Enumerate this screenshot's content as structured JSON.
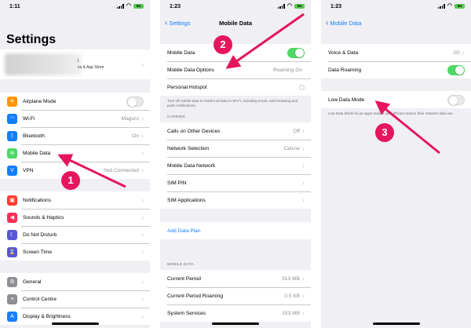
{
  "theme": {
    "accent": "#147efb",
    "toggle_on": "#4cd964",
    "annotation": "#e5165d"
  },
  "s1": {
    "time": "1:11",
    "battery": "84",
    "title": "Settings",
    "profile": {
      "line1": "i",
      "line2": "es & App Store"
    },
    "g1": [
      {
        "label": "Airplane Mode",
        "icon": "airplane-icon",
        "color": "#ff9500",
        "glyph": "✈",
        "toggle": "off"
      },
      {
        "label": "Wi-Fi",
        "icon": "wifi-icon",
        "color": "#147efb",
        "glyph": "◠",
        "value": "Maguro"
      },
      {
        "label": "Bluetooth",
        "icon": "bluetooth-icon",
        "color": "#147efb",
        "glyph": "ᛒ",
        "value": "On"
      },
      {
        "label": "Mobile Data",
        "icon": "antenna-icon",
        "color": "#4cd964",
        "glyph": "⊚",
        "value": ""
      },
      {
        "label": "VPN",
        "icon": "vpn-icon",
        "color": "#147efb",
        "glyph": "V",
        "value": "Not Connected"
      }
    ],
    "g2": [
      {
        "label": "Notifications",
        "icon": "notifications-icon",
        "color": "#ff3b30",
        "glyph": "▣"
      },
      {
        "label": "Sounds & Haptics",
        "icon": "speaker-icon",
        "color": "#ff2d55",
        "glyph": "◀"
      },
      {
        "label": "Do Not Disturb",
        "icon": "moon-icon",
        "color": "#5856d6",
        "glyph": "☾"
      },
      {
        "label": "Screen Time",
        "icon": "hourglass-icon",
        "color": "#5856d6",
        "glyph": "⌛"
      }
    ],
    "g3": [
      {
        "label": "General",
        "icon": "gear-icon",
        "color": "#8e8e93",
        "glyph": "⚙"
      },
      {
        "label": "Control Centre",
        "icon": "toggles-icon",
        "color": "#8e8e93",
        "glyph": "≡"
      },
      {
        "label": "Display & Brightness",
        "icon": "brightness-icon",
        "color": "#147efb",
        "glyph": "A"
      }
    ]
  },
  "s2": {
    "time": "1:23",
    "battery": "84",
    "back": "Settings",
    "title": "Mobile Data",
    "g1": [
      {
        "label": "Mobile Data",
        "toggle": "on"
      },
      {
        "label": "Mobile Data Options",
        "value": "Roaming On"
      },
      {
        "label": "Personal Hotspot",
        "spinner": true
      }
    ],
    "note": "Turn off mobile data to restrict all data to Wi-Fi, including email, web browsing and push notifications.",
    "carrier_header": "CARRIER",
    "g2": [
      {
        "label": "Calls on Other Devices",
        "value": "Off"
      },
      {
        "label": "Network Selection",
        "value": "Celcne"
      },
      {
        "label": "Mobile Data Network",
        "value": ""
      },
      {
        "label": "SIM PIN",
        "value": ""
      },
      {
        "label": "SIM Applications",
        "value": ""
      }
    ],
    "add_plan": "Add Data Plan",
    "mobile_header": "MOBILE DATA",
    "g3": [
      {
        "label": "Current Period",
        "value": "513 MB"
      },
      {
        "label": "Current Period Roaming",
        "value": "0.5 KB"
      },
      {
        "label": "System Services",
        "value": "153 MB"
      }
    ]
  },
  "s3": {
    "time": "1:23",
    "battery": "84",
    "back": "Mobile Data",
    "g1": [
      {
        "label": "Voice & Data",
        "value": "2G"
      },
      {
        "label": "Data Roaming",
        "toggle": "on"
      }
    ],
    "g2": [
      {
        "label": "Low Data Mode",
        "toggle": "off"
      }
    ],
    "note": "Low Data Mode he ps apps reduce your iPhone reduce their network data use."
  },
  "markers": [
    "1",
    "2",
    "3"
  ]
}
